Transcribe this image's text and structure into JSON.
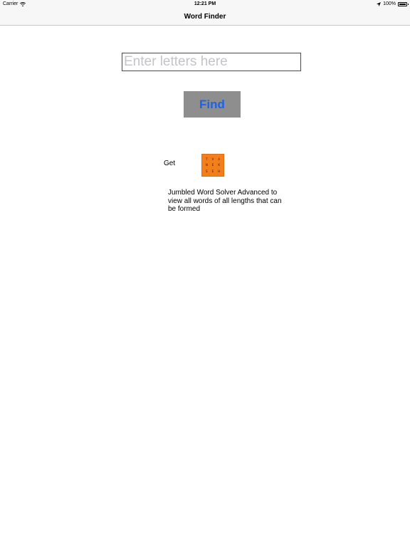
{
  "status_bar": {
    "carrier": "Carrier",
    "time": "12:21 PM",
    "battery": "100%",
    "icons": [
      "wifi-icon",
      "location-icon",
      "battery-icon"
    ]
  },
  "nav": {
    "title": "Word Finder"
  },
  "search": {
    "value": "",
    "placeholder": "Enter letters here"
  },
  "find_button": {
    "label": "Find",
    "color": "#1a64e8",
    "background": "#8e8e8e"
  },
  "promo": {
    "get_label": "Get",
    "icon_letters": [
      "T",
      "V",
      "A",
      "N",
      "E",
      "K",
      "S",
      "E",
      "H"
    ],
    "icon_color": "#f47e1a",
    "description": "Jumbled Word Solver Advanced to view all words of all lengths that can be formed"
  }
}
